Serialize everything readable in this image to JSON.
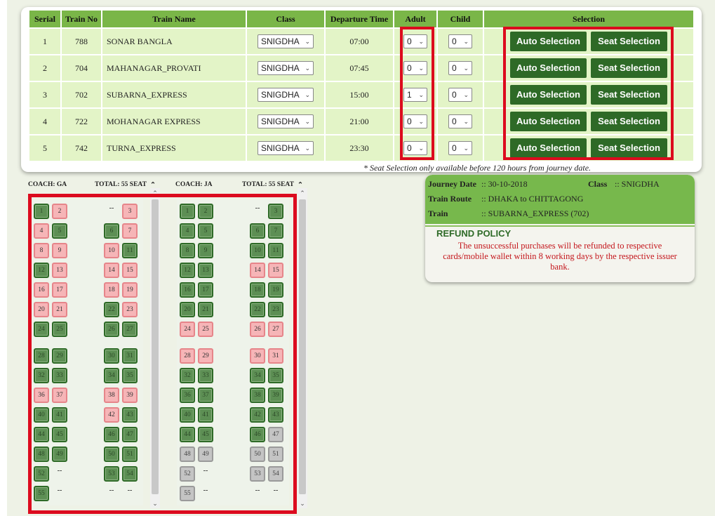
{
  "table": {
    "headers": {
      "serial": "Serial",
      "train_no": "Train No",
      "train_name": "Train Name",
      "class": "Class",
      "departure": "Departure Time",
      "adult": "Adult",
      "child": "Child",
      "selection": "Selection"
    },
    "rows": [
      {
        "serial": "1",
        "train_no": "788",
        "name": "SONAR BANGLA",
        "class": "SNIGDHA",
        "departure": "07:00",
        "adult": "0",
        "child": "0"
      },
      {
        "serial": "2",
        "train_no": "704",
        "name": "MAHANAGAR_PROVATI",
        "class": "SNIGDHA",
        "departure": "07:45",
        "adult": "0",
        "child": "0"
      },
      {
        "serial": "3",
        "train_no": "702",
        "name": "SUBARNA_EXPRESS",
        "class": "SNIGDHA",
        "departure": "15:00",
        "adult": "1",
        "child": "0"
      },
      {
        "serial": "4",
        "train_no": "722",
        "name": "MOHANAGAR EXPRESS",
        "class": "SNIGDHA",
        "departure": "21:00",
        "adult": "0",
        "child": "0"
      },
      {
        "serial": "5",
        "train_no": "742",
        "name": "TURNA_EXPRESS",
        "class": "SNIGDHA",
        "departure": "23:30",
        "adult": "0",
        "child": "0"
      }
    ],
    "auto_label": "Auto Selection",
    "seat_label": "Seat Selection",
    "note": "* Seat Selection only available before 120 hours from journey date."
  },
  "coaches": [
    {
      "name_label": "COACH: GA",
      "total_label": "TOTAL: 55 SEAT",
      "booked": [
        2,
        3,
        4,
        7,
        8,
        9,
        10,
        13,
        14,
        15,
        16,
        17,
        18,
        19,
        20,
        21,
        23,
        36,
        37,
        38,
        39,
        42
      ],
      "unavailable": []
    },
    {
      "name_label": "COACH: JA",
      "total_label": "TOTAL: 55 SEAT",
      "booked": [
        14,
        15,
        24,
        25,
        26,
        27,
        28,
        29,
        30,
        31
      ],
      "unavailable": [
        47,
        48,
        49,
        50,
        51,
        52,
        53,
        54,
        55
      ]
    }
  ],
  "info": {
    "journey_date_label": "Journey Date",
    "journey_date": ":: 30-10-2018",
    "class_label": "Class",
    "class": ":: SNIGDHA",
    "route_label": "Train Route",
    "route": ":: DHAKA to CHITTAGONG",
    "train_label": "Train",
    "train": ":: SUBARNA_EXPRESS (702)",
    "refund_title": "REFUND POLICY",
    "refund_text": "The unsuccessful purchases will be refunded to respective cards/mobile wallet within 8 working days by the respective issuer bank."
  },
  "icons": {
    "dropdown": "chevron-down-icon",
    "scroll_up": "chevron-up-icon",
    "scroll_down": "chevron-down-icon"
  },
  "colors": {
    "accent_green": "#2e6a27",
    "header_green": "#7ab648",
    "row_green": "#e3f4c7",
    "highlight_red": "#dc0b1e",
    "booked_pink": "#f6b5b7",
    "unavailable_grey": "#c4c4c4"
  }
}
